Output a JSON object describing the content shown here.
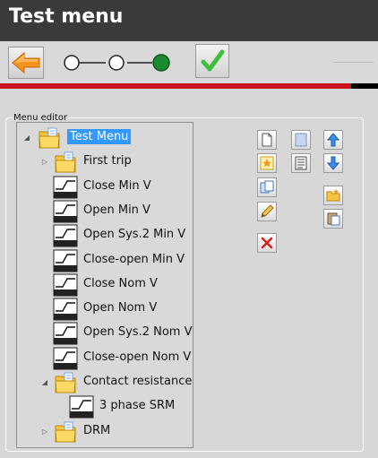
{
  "window": {
    "title": "Test menu"
  },
  "toolbar": {
    "back_icon": "arrow-left-icon",
    "confirm_icon": "checkmark-icon",
    "steps_total": 3,
    "steps_done": 3,
    "progress_fraction": 0.93
  },
  "editor": {
    "legend": "Menu editor",
    "tree": [
      {
        "label": "Test Menu",
        "type": "folder",
        "level": 0,
        "expander": "expanded",
        "selected": true
      },
      {
        "label": "First trip",
        "type": "folder",
        "level": 1,
        "expander": "collapsed"
      },
      {
        "label": "Close Min V",
        "type": "test",
        "level": 1
      },
      {
        "label": "Open Min V",
        "type": "test",
        "level": 1
      },
      {
        "label": "Open Sys.2 Min V",
        "type": "test",
        "level": 1
      },
      {
        "label": "Close-open Min V",
        "type": "test",
        "level": 1
      },
      {
        "label": "Close Nom V",
        "type": "test",
        "level": 1
      },
      {
        "label": "Open Nom V",
        "type": "test",
        "level": 1
      },
      {
        "label": "Open Sys.2 Nom V",
        "type": "test",
        "level": 1
      },
      {
        "label": "Close-open Nom V",
        "type": "test",
        "level": 1
      },
      {
        "label": "Contact resistance",
        "type": "folder",
        "level": 1,
        "expander": "expanded"
      },
      {
        "label": "3 phase SRM",
        "type": "test",
        "level": 2
      },
      {
        "label": "DRM",
        "type": "folder",
        "level": 1,
        "expander": "collapsed"
      }
    ],
    "buttons": [
      {
        "icon": "new-document-icon"
      },
      {
        "icon": "list-icon"
      },
      {
        "icon": "move-up-icon"
      },
      {
        "icon": "favorite-star-icon"
      },
      {
        "icon": "properties-icon"
      },
      {
        "icon": "move-down-icon"
      },
      {
        "icon": "copy-icon"
      },
      {
        "icon": "new-folder-icon"
      },
      {
        "icon": "edit-pencil-icon"
      },
      {
        "icon": "paste-icon"
      },
      {
        "icon": "delete-icon"
      }
    ]
  },
  "colors": {
    "title_bg": "#3a3a3a",
    "selection": "#3399ff",
    "progress": "#c9161d",
    "step_done": "#1a8a2e"
  }
}
